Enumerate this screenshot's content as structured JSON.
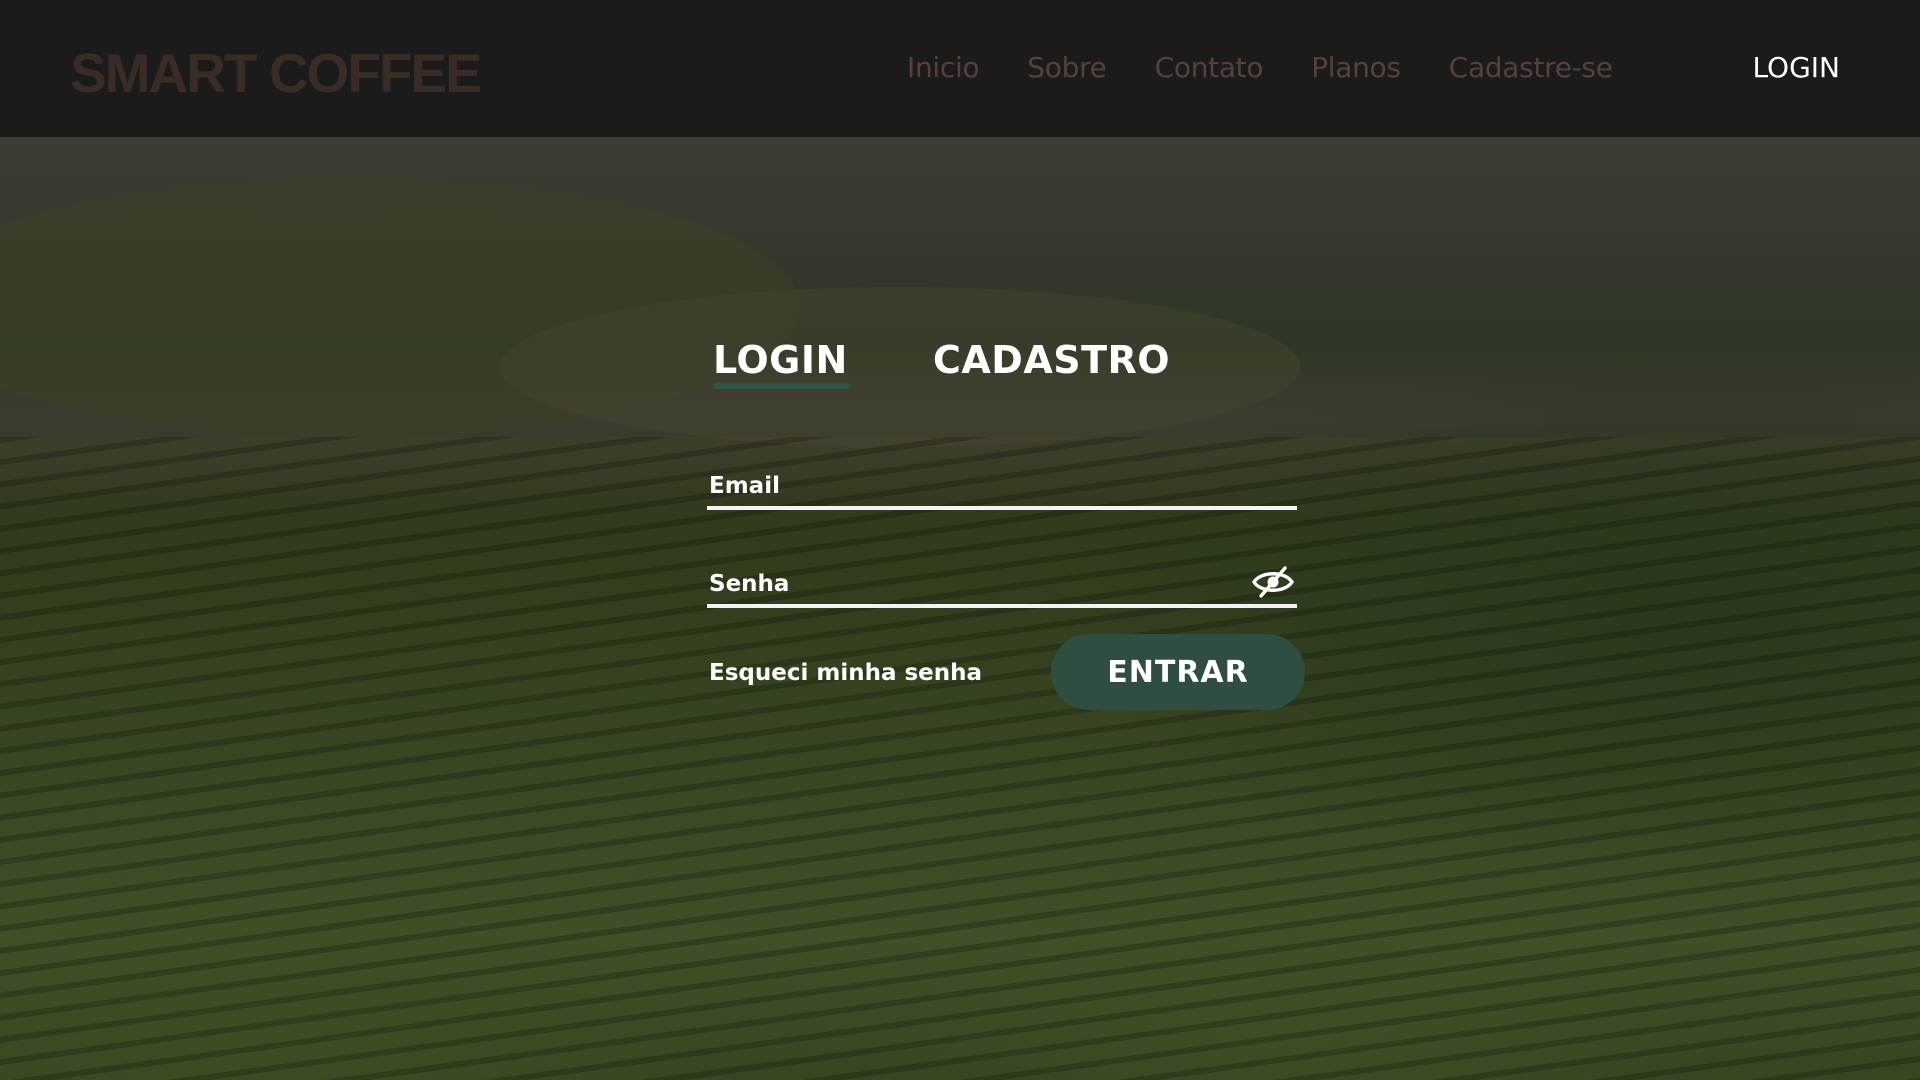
{
  "header": {
    "brand": "SMART COFFEE",
    "nav": [
      {
        "label": "Inicio"
      },
      {
        "label": "Sobre"
      },
      {
        "label": "Contato"
      },
      {
        "label": "Planos"
      },
      {
        "label": "Cadastre-se"
      }
    ],
    "login_label": "LOGIN"
  },
  "form": {
    "tabs": {
      "login": "LOGIN",
      "cadastro": "CADASTRO",
      "active": "login"
    },
    "email": {
      "placeholder": "Email",
      "value": ""
    },
    "senha": {
      "placeholder": "Senha",
      "value": "",
      "toggle_icon": "eye-slash-icon"
    },
    "forgot_label": "Esqueci minha senha",
    "submit_label": "ENTRAR"
  },
  "colors": {
    "header_bg": "#1b1b1b",
    "brand": "#3b2b25",
    "nav_link": "#56413a",
    "accent": "#2f4d40",
    "tab_underline": "#2f5548"
  }
}
